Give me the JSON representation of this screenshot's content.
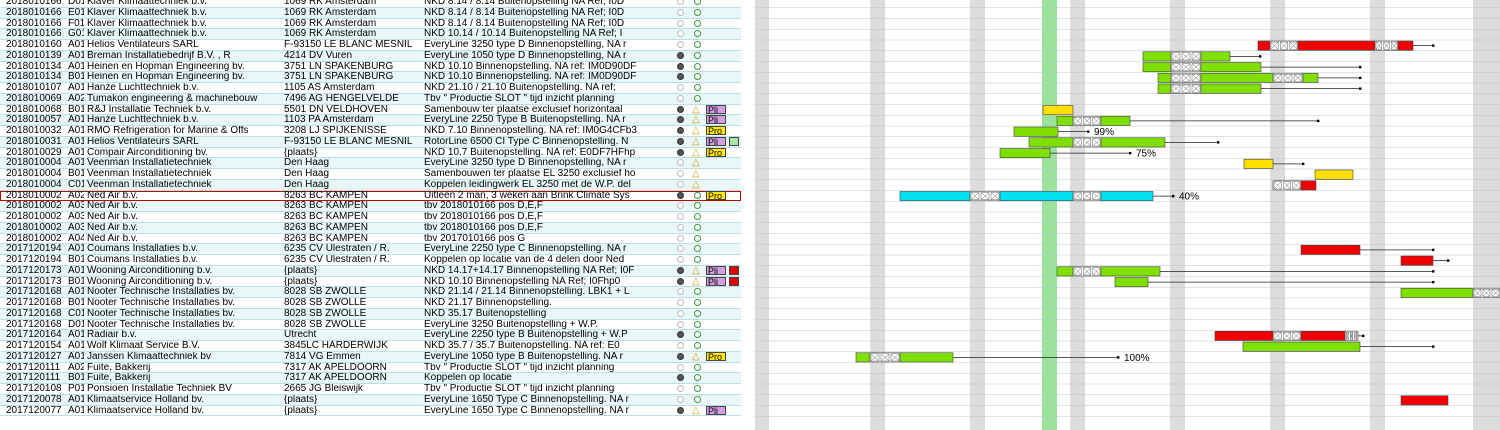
{
  "rows": [
    {
      "id": "2018010166",
      "pos": "D01",
      "name": "Klaver Klimaattechniek b.v.",
      "addr": "1069 RK Amsterdam",
      "desc": "NKD 8.14 / 8.14 Buitenopstelling NA Ref; I0D",
      "c1": "empty",
      "warn": false,
      "badge": "",
      "flag": ""
    },
    {
      "id": "2018010166",
      "pos": "E01",
      "name": "Klaver Klimaattechniek b.v.",
      "addr": "1069 RK Amsterdam",
      "desc": "NKD 8.14 / 8.14 Buitenopstelling NA Ref; I0D",
      "c1": "empty",
      "warn": false,
      "badge": "",
      "flag": ""
    },
    {
      "id": "2018010166",
      "pos": "F01",
      "name": "Klaver Klimaattechniek b.v.",
      "addr": "1069 RK Amsterdam",
      "desc": "NKD 8.14 / 8.14 Buitenopstelling NA Ref; I0D",
      "c1": "empty",
      "warn": false,
      "badge": "",
      "flag": ""
    },
    {
      "id": "2018010166",
      "pos": "G01",
      "name": "Klaver Klimaattechniek b.v.",
      "addr": "1069 RK Amsterdam",
      "desc": "NKD 10.14 / 10.14 Buitenopstelling NA Ref; I",
      "c1": "empty",
      "warn": false,
      "badge": "",
      "flag": ""
    },
    {
      "id": "2018010160",
      "pos": "A01",
      "name": "Helios Ventilateurs SARL",
      "addr": "F-93150 LE BLANC MESNIL",
      "desc": "EveryLine 3250 type D Binnenopstelling, NA r",
      "c1": "empty",
      "warn": false,
      "badge": "",
      "flag": ""
    },
    {
      "id": "2018010139",
      "pos": "A01",
      "name": "Breman Installatiebedrijf B.V. , R",
      "addr": "4214 DV Vuren",
      "desc": "EveryLine 1050 type D Binnenopstelling, NA r",
      "c1": "dark",
      "warn": false,
      "badge": "",
      "flag": ""
    },
    {
      "id": "2018010134",
      "pos": "A01",
      "name": "Heinen en Hopman Engineering bv.",
      "addr": "3751 LN SPAKENBURG",
      "desc": "NKD 10.10 Binnenopstelling. NA ref: IM0D90DF",
      "c1": "dark",
      "warn": false,
      "badge": "",
      "flag": ""
    },
    {
      "id": "2018010134",
      "pos": "B01",
      "name": "Heinen en Hopman Engineering bv.",
      "addr": "3751 LN SPAKENBURG",
      "desc": "NKD 10.10 Binnenopstelling. NA ref: IM0D90DF",
      "c1": "dark",
      "warn": false,
      "badge": "",
      "flag": ""
    },
    {
      "id": "2018010107",
      "pos": "A01",
      "name": "Hanze Luchttechniek b.v.",
      "addr": "1105 AS Amsterdam",
      "desc": "NKD 21.10 / 21.10 Buitenopstelling. NA ref;",
      "c1": "empty",
      "warn": false,
      "badge": "",
      "flag": ""
    },
    {
      "id": "2018010069",
      "pos": "A02",
      "name": "Tumakon engineering & machinebouw",
      "addr": "7496 AG HENGELVELDE",
      "desc": "Tbv \" Productie SLOT \" tijd inzicht planning",
      "c1": "empty",
      "warn": false,
      "badge": "",
      "flag": ""
    },
    {
      "id": "2018010068",
      "pos": "B01",
      "name": "R&J Installatie Techniek b.v.",
      "addr": "5501 DN VELDHOVEN",
      "desc": "Samenbouw ter plaatse exclusief horizontaal",
      "c1": "dark",
      "warn": true,
      "badge": "Pli",
      "flag": ""
    },
    {
      "id": "2018010057",
      "pos": "A01",
      "name": "Hanze Luchttechniek b.v.",
      "addr": "1103 PA Amsterdam",
      "desc": "EveryLine 2250 Type B Buitenopstelling. NA r",
      "c1": "dark",
      "warn": true,
      "badge": "Pli",
      "flag": ""
    },
    {
      "id": "2018010032",
      "pos": "A01",
      "name": "RMO Refrigeration for Marine & Offs",
      "addr": "3208 LJ SPIJKENISSE",
      "desc": "NKD 7.10 Binnenopstelling. NA ref: IM0G4CFb3",
      "c1": "dark",
      "warn": true,
      "badge": "Pro",
      "flag": ""
    },
    {
      "id": "2018010031",
      "pos": "A01",
      "name": "Helios Ventilateurs SARL",
      "addr": "F-93150 LE BLANC MESNIL",
      "desc": "RotorLine 6500 CI Type C Binnenopstelling. N",
      "c1": "dark",
      "warn": true,
      "badge": "Pli",
      "flag": "green"
    },
    {
      "id": "2018010029",
      "pos": "A01",
      "name": "Compair Airconditioning bv.",
      "addr": "{plaats}",
      "desc": "NKD 10.7 Buitenopstelling. NA ref: E0DF7HFhp",
      "c1": "dark",
      "warn": true,
      "badge": "Pro",
      "flag": ""
    },
    {
      "id": "2018010004",
      "pos": "A01",
      "name": "Veenman Installatietechniek",
      "addr": "Den Haag",
      "desc": "EveryLine 3250 type D Binnenopstelling, NA r",
      "c1": "empty",
      "warn": true,
      "badge": "",
      "flag": ""
    },
    {
      "id": "2018010004",
      "pos": "B01",
      "name": "Veenman Installatietechniek",
      "addr": "Den Haag",
      "desc": "Samenbouwen ter plaatse EL 3250 exclusief ho",
      "c1": "empty",
      "warn": true,
      "badge": "",
      "flag": ""
    },
    {
      "id": "2018010004",
      "pos": "C01",
      "name": "Veenman Installatietechniek",
      "addr": "Den Haag",
      "desc": "Koppelen leidingwerk EL 3250 met de W.P. del",
      "c1": "empty",
      "warn": true,
      "badge": "",
      "flag": ""
    },
    {
      "id": "2018010002",
      "pos": "A02",
      "name": "Ned Air b.v.",
      "addr": "8263 BC KAMPEN",
      "desc": "Uitleen 2 man, 3 weken aan Brink Climate Sys",
      "c1": "dark",
      "warn": false,
      "badge": "Pro",
      "flag": "",
      "sel": true
    },
    {
      "id": "2018010002",
      "pos": "A03",
      "name": "Ned Air b.v.",
      "addr": "8263 BC KAMPEN",
      "desc": "tbv 2018010166 pos D,E,F",
      "c1": "empty",
      "warn": false,
      "badge": "",
      "flag": ""
    },
    {
      "id": "2018010002",
      "pos": "A03",
      "name": "Ned Air b.v.",
      "addr": "8263 BC KAMPEN",
      "desc": "tbv 2018010166 pos D,E,F",
      "c1": "empty",
      "warn": false,
      "badge": "",
      "flag": ""
    },
    {
      "id": "2018010002",
      "pos": "A03",
      "name": "Ned Air b.v.",
      "addr": "8263 BC KAMPEN",
      "desc": "tbv 2018010166 pos D,E,F",
      "c1": "empty",
      "warn": false,
      "badge": "",
      "flag": ""
    },
    {
      "id": "2018010002",
      "pos": "A04",
      "name": "Ned Air b.v.",
      "addr": "8263 BC KAMPEN",
      "desc": "tbv 2017010166 pos G",
      "c1": "empty",
      "warn": false,
      "badge": "",
      "flag": ""
    },
    {
      "id": "2017120194",
      "pos": "A01",
      "name": "Coumans Installaties b.v.",
      "addr": "6235 CV Ulestraten / R.",
      "desc": "EveryLine 2250 type C Binnenopstelling. NA r",
      "c1": "empty",
      "warn": false,
      "badge": "",
      "flag": ""
    },
    {
      "id": "2017120194",
      "pos": "B01",
      "name": "Coumans Installaties b.v.",
      "addr": "6235 CV Ulestraten / R.",
      "desc": "Koppelen op locatie van de 4 delen door Ned",
      "c1": "empty",
      "warn": false,
      "badge": "",
      "flag": ""
    },
    {
      "id": "2017120173",
      "pos": "A01",
      "name": "Wooning Airconditioning b.v.",
      "addr": "{plaats}",
      "desc": "NKD 14.17+14.17 Binnenopstelling NA Ref; I0F",
      "c1": "dark",
      "warn": true,
      "badge": "Pli",
      "flag": "red"
    },
    {
      "id": "2017120173",
      "pos": "B01",
      "name": "Wooning Airconditioning b.v.",
      "addr": "{plaats}",
      "desc": "NKD 10.10 Binnenopstelling NA Ref; I0Fhp0",
      "c1": "dark",
      "warn": true,
      "badge": "Pli",
      "flag": "red"
    },
    {
      "id": "2017120168",
      "pos": "A01",
      "name": "Nooter Technische Installaties bv.",
      "addr": "8028 SB ZWOLLE",
      "desc": "NKD 21.14 / 21.14 Binnenopstelling. LBK1 + L",
      "c1": "empty",
      "warn": false,
      "badge": "",
      "flag": ""
    },
    {
      "id": "2017120168",
      "pos": "B01",
      "name": "Nooter Technische Installaties bv.",
      "addr": "8028 SB ZWOLLE",
      "desc": "NKD 21.17 Binnenopstelling.",
      "c1": "empty",
      "warn": false,
      "badge": "",
      "flag": ""
    },
    {
      "id": "2017120168",
      "pos": "C01",
      "name": "Nooter Technische Installaties bv.",
      "addr": "8028 SB ZWOLLE",
      "desc": "NKD 35.17 Buitenopstelling",
      "c1": "empty",
      "warn": false,
      "badge": "",
      "flag": ""
    },
    {
      "id": "2017120168",
      "pos": "D01",
      "name": "Nooter Technische Installaties bv.",
      "addr": "8028 SB ZWOLLE",
      "desc": "EveryLine 3250 Buitenopstelling + W.P.",
      "c1": "empty",
      "warn": false,
      "badge": "",
      "flag": ""
    },
    {
      "id": "2017120164",
      "pos": "A01",
      "name": "Radiair b.v.",
      "addr": "Utrecht",
      "desc": "EveryLine 2250 type B Buitenopstelling + W.P",
      "c1": "dark",
      "warn": false,
      "badge": "",
      "flag": ""
    },
    {
      "id": "2017120154",
      "pos": "A01",
      "name": "Wolf Klimaat Service B.V.",
      "addr": "3845LC HARDERWIJK",
      "desc": "NKD 35.7 / 35.7 Buitenopstelling. NA ref: E0",
      "c1": "empty",
      "warn": false,
      "badge": "",
      "flag": ""
    },
    {
      "id": "2017120127",
      "pos": "A01",
      "name": "Janssen Klimaattechniek bv",
      "addr": "7814 VG Emmen",
      "desc": "EveryLine 1050 type B Buitenopstelling. NA r",
      "c1": "dark",
      "warn": true,
      "badge": "Pro",
      "flag": ""
    },
    {
      "id": "2017120111",
      "pos": "A02",
      "name": "Fuite, Bakkerij",
      "addr": "7317 AK APELDOORN",
      "desc": "Tbv \" Productie SLOT \" tijd inzicht planning",
      "c1": "empty",
      "warn": false,
      "badge": "",
      "flag": ""
    },
    {
      "id": "2017120111",
      "pos": "B01",
      "name": "Fuite, Bakkerij",
      "addr": "7317 AK APELDOORN",
      "desc": "Koppelen op locatie",
      "c1": "dark",
      "warn": false,
      "badge": "",
      "flag": ""
    },
    {
      "id": "2017120108",
      "pos": "P01",
      "name": "Ponsioen Installatie Techniek BV",
      "addr": "2665 JG Bleiswijk",
      "desc": "Tbv \" Productie SLOT \" tijd inzicht planning",
      "c1": "empty",
      "warn": false,
      "badge": "",
      "flag": ""
    },
    {
      "id": "2017120078",
      "pos": "A01",
      "name": "Klimaatservice Holland bv.",
      "addr": "{plaats}",
      "desc": "EveryLine 1650 Type C Binnenopstelling. NA r",
      "c1": "empty",
      "warn": false,
      "badge": "",
      "flag": ""
    },
    {
      "id": "2017120077",
      "pos": "A01",
      "name": "Klimaatservice Holland bv.",
      "addr": "{plaats}",
      "desc": "EveryLine 1650 Type C Binnenopstelling. NA r",
      "c1": "dark",
      "warn": true,
      "badge": "Pli",
      "flag": ""
    }
  ],
  "gantt": {
    "grey_columns": [
      [
        0,
        14
      ],
      [
        115,
        15
      ],
      [
        215,
        15
      ],
      [
        315,
        15
      ],
      [
        415,
        15
      ],
      [
        515,
        15
      ],
      [
        615,
        15
      ],
      [
        718,
        27
      ]
    ],
    "today_column": [
      287,
      15
    ],
    "bars": [
      {
        "row": 4,
        "segs": [
          [
            "red",
            503,
            515
          ],
          [
            "x",
            515,
            543
          ],
          [
            "red",
            543,
            620
          ],
          [
            "x",
            620,
            643
          ],
          [
            "red",
            643,
            658
          ]
        ],
        "end": 678
      },
      {
        "row": 5,
        "segs": [
          [
            "green",
            388,
            416
          ],
          [
            "x",
            416,
            446
          ],
          [
            "green",
            446,
            475
          ]
        ],
        "end": 505
      },
      {
        "row": 6,
        "segs": [
          [
            "green",
            388,
            416
          ],
          [
            "x",
            416,
            446
          ],
          [
            "green",
            446,
            506
          ]
        ],
        "end": 605
      },
      {
        "row": 7,
        "segs": [
          [
            "green",
            403,
            416
          ],
          [
            "x",
            416,
            446
          ],
          [
            "green",
            446,
            518
          ],
          [
            "x",
            518,
            548
          ],
          [
            "green",
            548,
            563
          ]
        ],
        "end": 605
      },
      {
        "row": 8,
        "segs": [
          [
            "green",
            403,
            416
          ],
          [
            "x",
            416,
            446
          ],
          [
            "green",
            446,
            506
          ]
        ],
        "end": 605
      },
      {
        "row": 10,
        "segs": [
          [
            "yellow",
            288,
            318
          ]
        ]
      },
      {
        "row": 11,
        "segs": [
          [
            "green",
            302,
            318
          ],
          [
            "x",
            318,
            346
          ],
          [
            "green",
            346,
            375
          ]
        ],
        "end": 563
      },
      {
        "row": 12,
        "segs": [
          [
            "green",
            259,
            303
          ]
        ],
        "end": 333,
        "label": "99%"
      },
      {
        "row": 13,
        "segs": [
          [
            "green",
            274,
            318
          ],
          [
            "x",
            318,
            346
          ],
          [
            "green",
            346,
            410
          ]
        ],
        "end": 463
      },
      {
        "row": 14,
        "segs": [
          [
            "green",
            245,
            295
          ]
        ],
        "end": 375,
        "label": "75%"
      },
      {
        "row": 15,
        "segs": [
          [
            "yellow",
            489,
            518
          ]
        ],
        "end": 548
      },
      {
        "row": 16,
        "segs": [
          [
            "yellow",
            560,
            598
          ]
        ]
      },
      {
        "row": 17,
        "segs": [
          [
            "x",
            518,
            546
          ],
          [
            "red",
            546,
            561
          ]
        ]
      },
      {
        "row": 18,
        "segs": [
          [
            "cyan",
            145,
            215
          ],
          [
            "x",
            215,
            245
          ],
          [
            "cyan",
            245,
            318
          ],
          [
            "x",
            318,
            346
          ],
          [
            "cyan",
            346,
            398
          ]
        ],
        "end": 418,
        "label": "40%"
      },
      {
        "row": 23,
        "segs": [
          [
            "red",
            546,
            605
          ]
        ],
        "end": 678
      },
      {
        "row": 24,
        "segs": [
          [
            "red",
            646,
            678
          ]
        ],
        "end": 693
      },
      {
        "row": 25,
        "segs": [
          [
            "green",
            302,
            318
          ],
          [
            "x",
            318,
            346
          ],
          [
            "green",
            346,
            405
          ]
        ],
        "end": 678
      },
      {
        "row": 26,
        "segs": [
          [
            "green",
            360,
            393
          ]
        ],
        "end": 678
      },
      {
        "row": 27,
        "segs": [
          [
            "green",
            646,
            718
          ],
          [
            "x",
            718,
            745
          ]
        ]
      },
      {
        "row": 31,
        "segs": [
          [
            "red",
            460,
            518
          ],
          [
            "x",
            518,
            546
          ],
          [
            "red",
            546,
            590
          ],
          [
            "x",
            590,
            603
          ]
        ],
        "end": 608
      },
      {
        "row": 32,
        "segs": [
          [
            "green",
            488,
            605
          ]
        ],
        "end": 678
      },
      {
        "row": 33,
        "segs": [
          [
            "green",
            101,
            115
          ],
          [
            "x",
            115,
            145
          ],
          [
            "green",
            145,
            198
          ]
        ],
        "end": 363,
        "label": "100%"
      },
      {
        "row": 37,
        "segs": [
          [
            "red",
            646,
            693
          ]
        ]
      }
    ]
  }
}
